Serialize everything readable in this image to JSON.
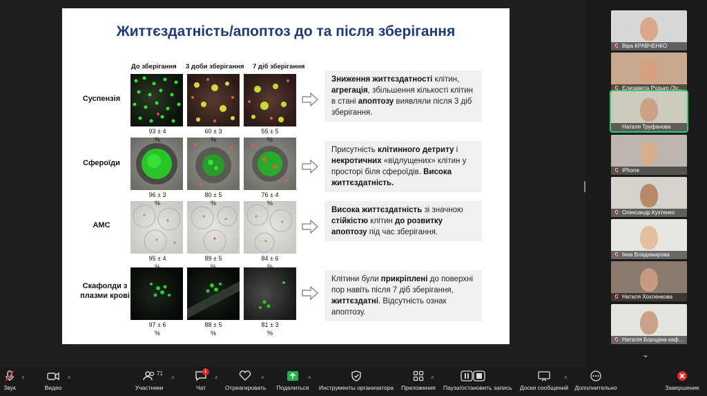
{
  "slide": {
    "title": "Життєздатність/апоптоз до та після зберігання",
    "columns": [
      "До зберігання",
      "3 доби зберігання",
      "7 діб зберігання"
    ],
    "rows": [
      {
        "label": "Суспензія",
        "values": [
          "93 ± 4",
          "60 ± 3",
          "55 ± 5"
        ]
      },
      {
        "label": "Сфероїди",
        "values": [
          "96 ± 3",
          "80 ± 5",
          "76 ± 4"
        ]
      },
      {
        "label": "АМС",
        "values": [
          "95 ± 4",
          "89 ± 5",
          "84 ± 6"
        ]
      },
      {
        "label": "Скафолди з плазми крові",
        "values": [
          "97 ± 6",
          "88 ± 5",
          "81 ± 3"
        ]
      }
    ],
    "unit": "%",
    "descriptions": [
      {
        "parts": [
          {
            "b": "Зниження життєздатності"
          },
          {
            "t": " клітин, "
          },
          {
            "b": "агрегація"
          },
          {
            "t": ", збільшення кількості клітин в стані "
          },
          {
            "b": "апоптозу"
          },
          {
            "t": " виявляли після 3 діб зберігання."
          }
        ]
      },
      {
        "parts": [
          {
            "t": "Присутність "
          },
          {
            "b": "клітинного детриту"
          },
          {
            "t": " і "
          },
          {
            "b": "некротичних"
          },
          {
            "t": " «відлущених» клітин у просторі біля сфероїдів. "
          },
          {
            "b": "Висока життєздатність."
          }
        ]
      },
      {
        "parts": [
          {
            "b": "Висока життєздатність"
          },
          {
            "t": " зі значною "
          },
          {
            "b": "стійкістю"
          },
          {
            "t": " клітин "
          },
          {
            "b": "до розвитку апоптозу"
          },
          {
            "t": " під час зберігання."
          }
        ]
      },
      {
        "parts": [
          {
            "t": "Клітини були "
          },
          {
            "b": "прикріплені"
          },
          {
            "t": " до поверхні пор навіть після 7 діб зберігання, "
          },
          {
            "b": "життєздатні"
          },
          {
            "t": ". Відсутність ознак апоптозу."
          }
        ]
      }
    ]
  },
  "participants": [
    {
      "name": "Віра КРАВЧЕНКО",
      "muted": true,
      "bg": "#d8d8d8",
      "face": "#d9a98a",
      "active": false
    },
    {
      "name": "Єлизавета Рудько (Зу...",
      "muted": true,
      "bg": "#c9a98e",
      "face": "#d4a07e",
      "active": false
    },
    {
      "name": "Наталя Труфанова",
      "muted": false,
      "bg": "#cfcabe",
      "face": "#caa086",
      "active": true
    },
    {
      "name": "iPhone",
      "muted": true,
      "bg": "#bdb6ae",
      "face": "#d8b090",
      "active": false
    },
    {
      "name": "Олександр Кухтенко",
      "muted": true,
      "bg": "#d6d3cc",
      "face": "#b98a6a",
      "active": false
    },
    {
      "name": "Інна Владимирова",
      "muted": true,
      "bg": "#e8e6e0",
      "face": "#e2c0a0",
      "active": false
    },
    {
      "name": "Наталя Хохленкова",
      "muted": true,
      "bg": "#8a7b6e",
      "face": "#c89a80",
      "active": false
    },
    {
      "name": "Наталія Бородіна каф...",
      "muted": true,
      "bg": "#e6e4de",
      "face": "#c9a088",
      "active": false
    }
  ],
  "toolbar": {
    "audio": "Звук",
    "video": "Видео",
    "participants": "Участники",
    "participants_count": "71",
    "chat": "Чат",
    "chat_badge": "1",
    "react": "Отреагировать",
    "share": "Поделиться",
    "host_tools": "Инструменты организатора",
    "apps": "Приложения",
    "record": "Пауза/остановить запись",
    "whiteboards": "Доски сообщений",
    "more": "Дополнительно",
    "end": "Завершение"
  },
  "colors": {
    "title": "#1f3a7a",
    "accent_green": "#2ecc71",
    "share_green": "#22b24c",
    "end_red": "#e02828"
  }
}
